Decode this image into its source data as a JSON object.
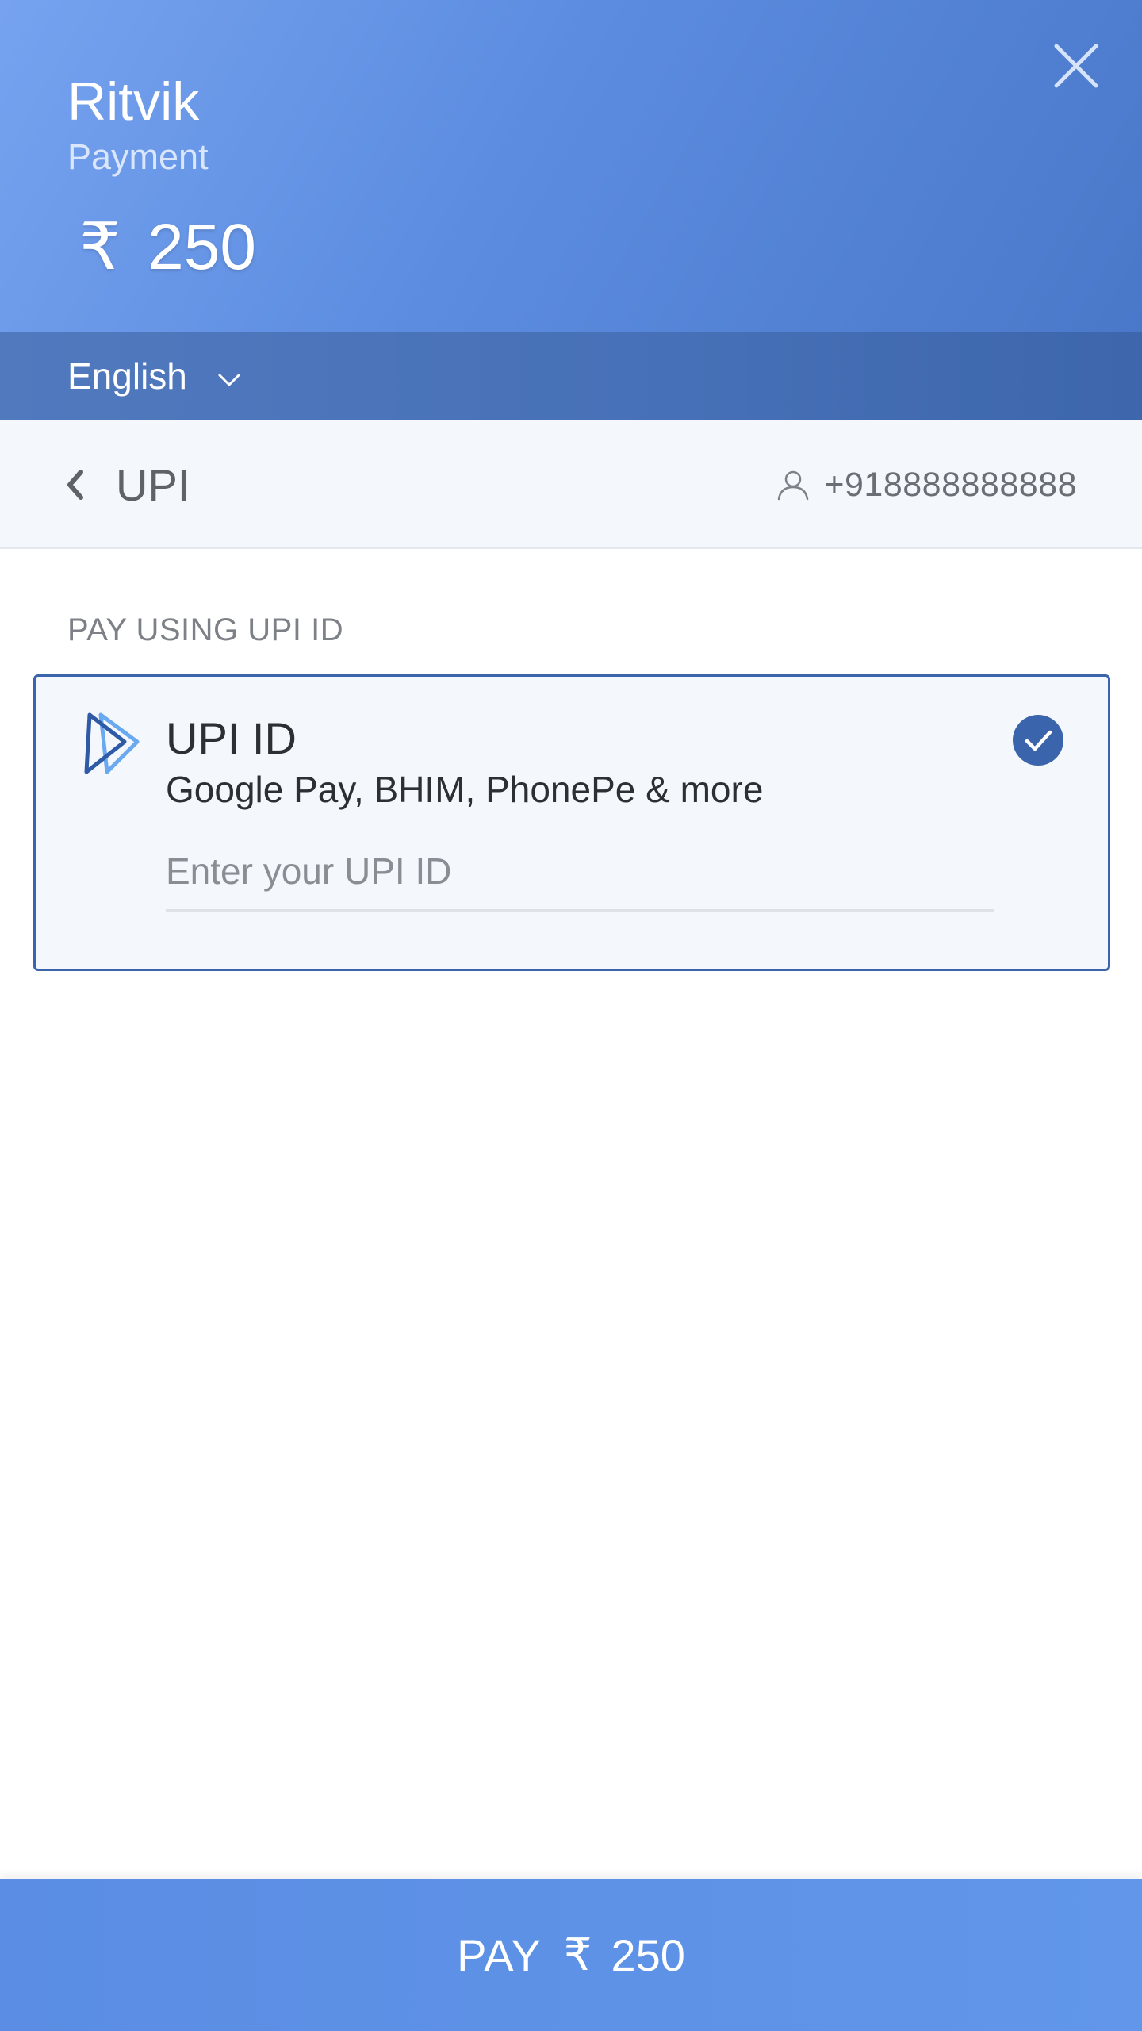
{
  "header": {
    "merchant_name": "Ritvik",
    "merchant_subtitle": "Payment",
    "currency_symbol": "₹",
    "amount": "250",
    "close_icon": "close-icon",
    "brand_color": "#5c8ce0"
  },
  "language": {
    "selected": "English",
    "icon": "chevron-down-icon"
  },
  "subnav": {
    "back_icon": "chevron-left-icon",
    "method_label": "UPI",
    "user_icon": "user-icon",
    "phone": "+918888888888"
  },
  "section": {
    "title": "PAY USING UPI ID"
  },
  "upi_option": {
    "logo_icon": "upi-logo-icon",
    "title": "UPI ID",
    "description": "Google Pay, BHIM, PhonePe & more",
    "input_placeholder": "Enter your UPI ID",
    "input_value": "",
    "selected": true,
    "check_icon": "check-circle-icon",
    "accent_color": "#3a64ab"
  },
  "pay_button": {
    "label": "PAY",
    "currency_symbol": "₹",
    "amount": "250"
  }
}
